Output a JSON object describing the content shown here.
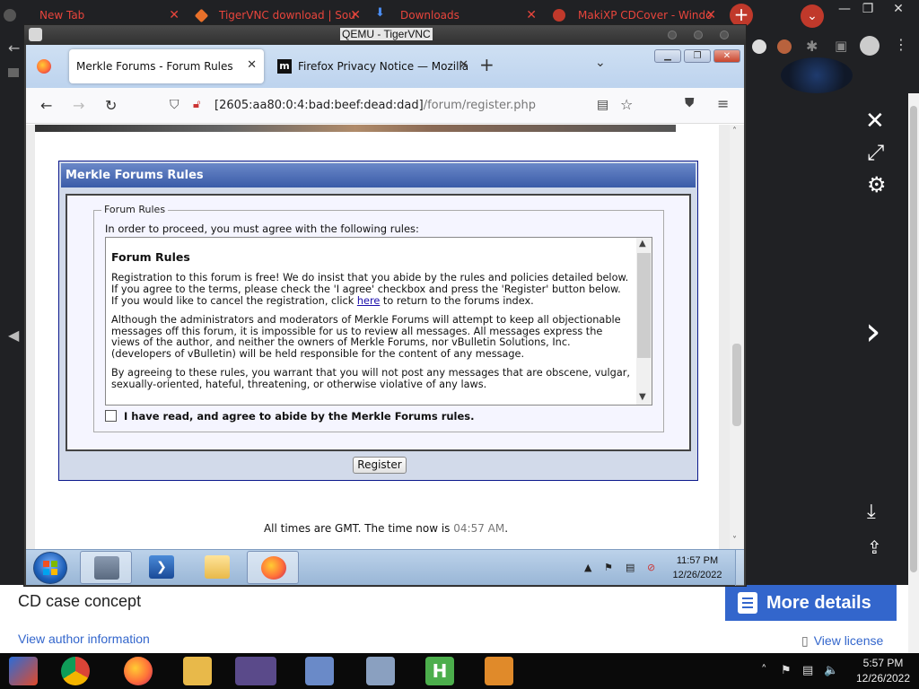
{
  "host": {
    "tabs": [
      {
        "label": "New Tab"
      },
      {
        "label": "TigerVNC download | Sou"
      },
      {
        "label": "Downloads"
      },
      {
        "label": "MakiXP CDCover - Windo"
      }
    ],
    "caption_title": "CD case concept",
    "more_details": "More details",
    "author_link": "View author information",
    "license_link": "View license",
    "clock_time": "5:57 PM",
    "clock_date": "12/26/2022"
  },
  "vnc": {
    "title": "QEMU - TigerVNC"
  },
  "firefox": {
    "tabs": [
      {
        "label": "Merkle Forums - Forum Rules"
      },
      {
        "label": "Firefox Privacy Notice — Mozilla",
        "icon": "m"
      }
    ],
    "url_host": "[2605:aa80:0:4:bad:beef:dead:dad]",
    "url_path": "/forum/register.php"
  },
  "page": {
    "panel_title": "Merkle Forums Rules",
    "fieldset_legend": "Forum Rules",
    "proceed_text": "In order to proceed, you must agree with the following rules:",
    "rules_title": "Forum Rules",
    "para1_before": "Registration to this forum is free! We do insist that you abide by the rules and policies detailed below. If you agree to the terms, please check the 'I agree' checkbox and press the 'Register' button below. If you would like to cancel the registration, click ",
    "para1_link": "here",
    "para1_after": " to return to the forums index.",
    "para2": "Although the administrators and moderators of Merkle Forums will attempt to keep all objectionable messages off this forum, it is impossible for us to review all messages. All messages express the views of the author, and neither the owners of Merkle Forums, nor vBulletin Solutions, Inc. (developers of vBulletin) will be held responsible for the content of any message.",
    "para3": "By agreeing to these rules, you warrant that you will not post any messages that are obscene, vulgar, sexually-oriented, hateful, threatening, or otherwise violative of any laws.",
    "agree_label": "I have read, and agree to abide by the Merkle Forums rules.",
    "register_label": "Register",
    "footer_prefix": "All times are GMT. The time now is ",
    "footer_time": "04:57 AM",
    "footer_suffix": "."
  },
  "guest_taskbar": {
    "clock_time": "11:57 PM",
    "clock_date": "12/26/2022"
  },
  "colors": {
    "panel_header": "#3a5ba8",
    "panel_border": "#0b198c",
    "host_accent": "#3366cc",
    "host_tab_text": "#e8453c"
  }
}
